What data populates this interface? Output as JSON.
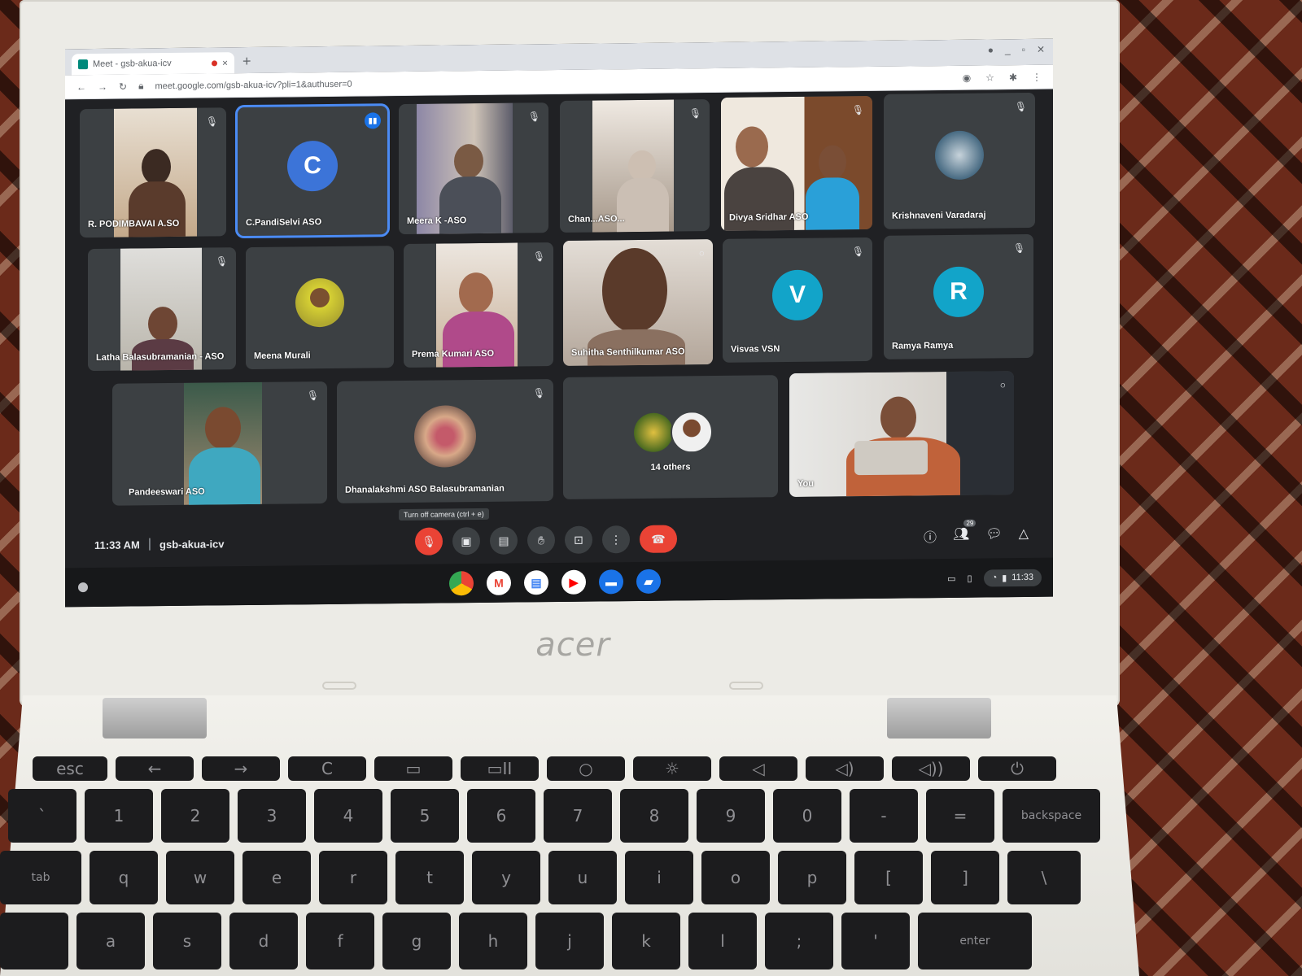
{
  "browser": {
    "tab_title": "Meet - gsb-akua-icv",
    "tab_close": "×",
    "new_tab": "+",
    "url": "meet.google.com/gsb-akua-icv?pli=1&authuser=0"
  },
  "participants": [
    {
      "name": "R. PODIMBAVAI A.SO",
      "kind": "video"
    },
    {
      "name": "C.PandiSelvi ASO",
      "kind": "initial",
      "initial": "C",
      "color": "#3c74d8"
    },
    {
      "name": "Meera K -ASO",
      "kind": "video"
    },
    {
      "name": "Chan...ASO...",
      "kind": "video"
    },
    {
      "name": "Divya Sridhar ASO",
      "kind": "video"
    },
    {
      "name": "Krishnaveni Varadaraj",
      "kind": "photo"
    },
    {
      "name": "Latha Balasubramanian - ASO",
      "kind": "video"
    },
    {
      "name": "Meena Murali",
      "kind": "photo"
    },
    {
      "name": "Prema Kumari ASO",
      "kind": "video"
    },
    {
      "name": "Suhitha Senthilkumar ASO",
      "kind": "video"
    },
    {
      "name": "Visvas VSN",
      "kind": "initial",
      "initial": "V",
      "color": "#12a4c9"
    },
    {
      "name": "Ramya Ramya",
      "kind": "initial",
      "initial": "R",
      "color": "#12a4c9"
    },
    {
      "name": "Pandeeswari ASO",
      "kind": "video"
    },
    {
      "name": "Dhanalakshmi ASO Balasubramanian",
      "kind": "photo"
    },
    {
      "name": "14 others",
      "kind": "others"
    },
    {
      "name": "You",
      "kind": "video"
    }
  ],
  "controls": {
    "time": "11:33 AM",
    "separator": "|",
    "meeting_code": "gsb-akua-icv",
    "tooltip": "Turn off camera (ctrl + e)",
    "people_count": "29"
  },
  "shelf": {
    "clock": "11:33"
  },
  "laptop": {
    "brand": "acer"
  },
  "keyboard": {
    "row1": [
      "esc",
      "←",
      "→",
      "C",
      "▭",
      "▭II",
      "○",
      "☼",
      "◁",
      "◁)",
      "◁))",
      "⏻"
    ],
    "row2": [
      "`",
      "1",
      "2",
      "3",
      "4",
      "5",
      "6",
      "7",
      "8",
      "9",
      "0",
      "-",
      "=",
      "backspace"
    ],
    "row3": [
      "tab",
      "q",
      "w",
      "e",
      "r",
      "t",
      "y",
      "u",
      "i",
      "o",
      "p",
      "[",
      "]",
      "\\"
    ],
    "row4": [
      "",
      "a",
      "s",
      "d",
      "f",
      "g",
      "h",
      "j",
      "k",
      "l",
      ";",
      "'",
      "enter"
    ]
  }
}
